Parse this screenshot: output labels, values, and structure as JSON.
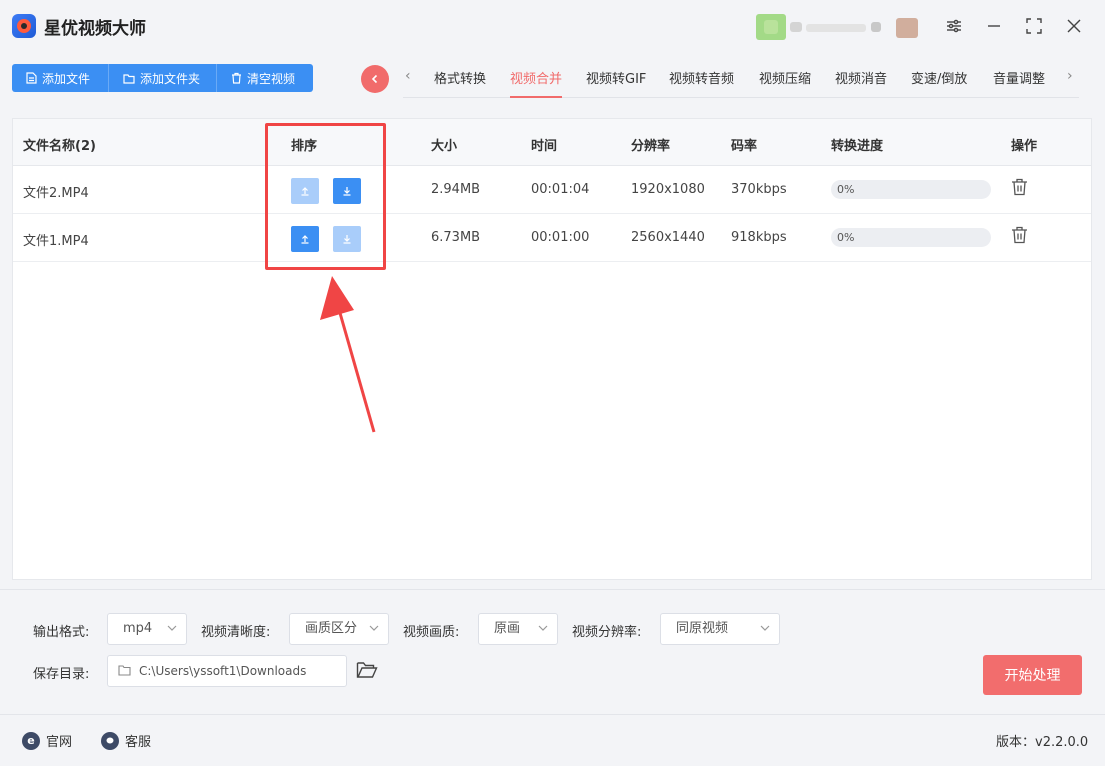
{
  "app": {
    "title": "星优视频大师"
  },
  "toolbar": {
    "add_file": "添加文件",
    "add_folder": "添加文件夹",
    "clear": "清空视频"
  },
  "tabs": [
    "格式转换",
    "视频合并",
    "视频转GIF",
    "视频转音频",
    "视频压缩",
    "视频消音",
    "变速/倒放",
    "音量调整"
  ],
  "active_tab": "视频合并",
  "table": {
    "headers": {
      "name": "文件名称(2)",
      "sort": "排序",
      "size": "大小",
      "time": "时间",
      "resolution": "分辨率",
      "bitrate": "码率",
      "progress": "转换进度",
      "action": "操作"
    },
    "rows": [
      {
        "name": "文件2.MP4",
        "size": "2.94MB",
        "time": "00:01:04",
        "resolution": "1920x1080",
        "bitrate": "370kbps",
        "progress_text": "0%",
        "progress": 0,
        "up_enabled": false,
        "down_enabled": true
      },
      {
        "name": "文件1.MP4",
        "size": "6.73MB",
        "time": "00:01:00",
        "resolution": "2560x1440",
        "bitrate": "918kbps",
        "progress_text": "0%",
        "progress": 0,
        "up_enabled": true,
        "down_enabled": false
      }
    ]
  },
  "settings": {
    "format_label": "输出格式:",
    "format_value": "mp4",
    "clarity_label": "视频清晰度:",
    "clarity_value": "画质区分",
    "quality_label": "视频画质:",
    "quality_value": "原画",
    "resolution_label": "视频分辨率:",
    "resolution_value": "同原视频",
    "dir_label": "保存目录:",
    "dir_value": "C:\\Users\\yssoft1\\Downloads"
  },
  "start_button": "开始处理",
  "footer": {
    "website": "官网",
    "support": "客服",
    "version": "版本：v2.2.0.0"
  },
  "colors": {
    "primary": "#3b8ff3",
    "accent": "#f16b6b",
    "highlight": "#f04545"
  }
}
